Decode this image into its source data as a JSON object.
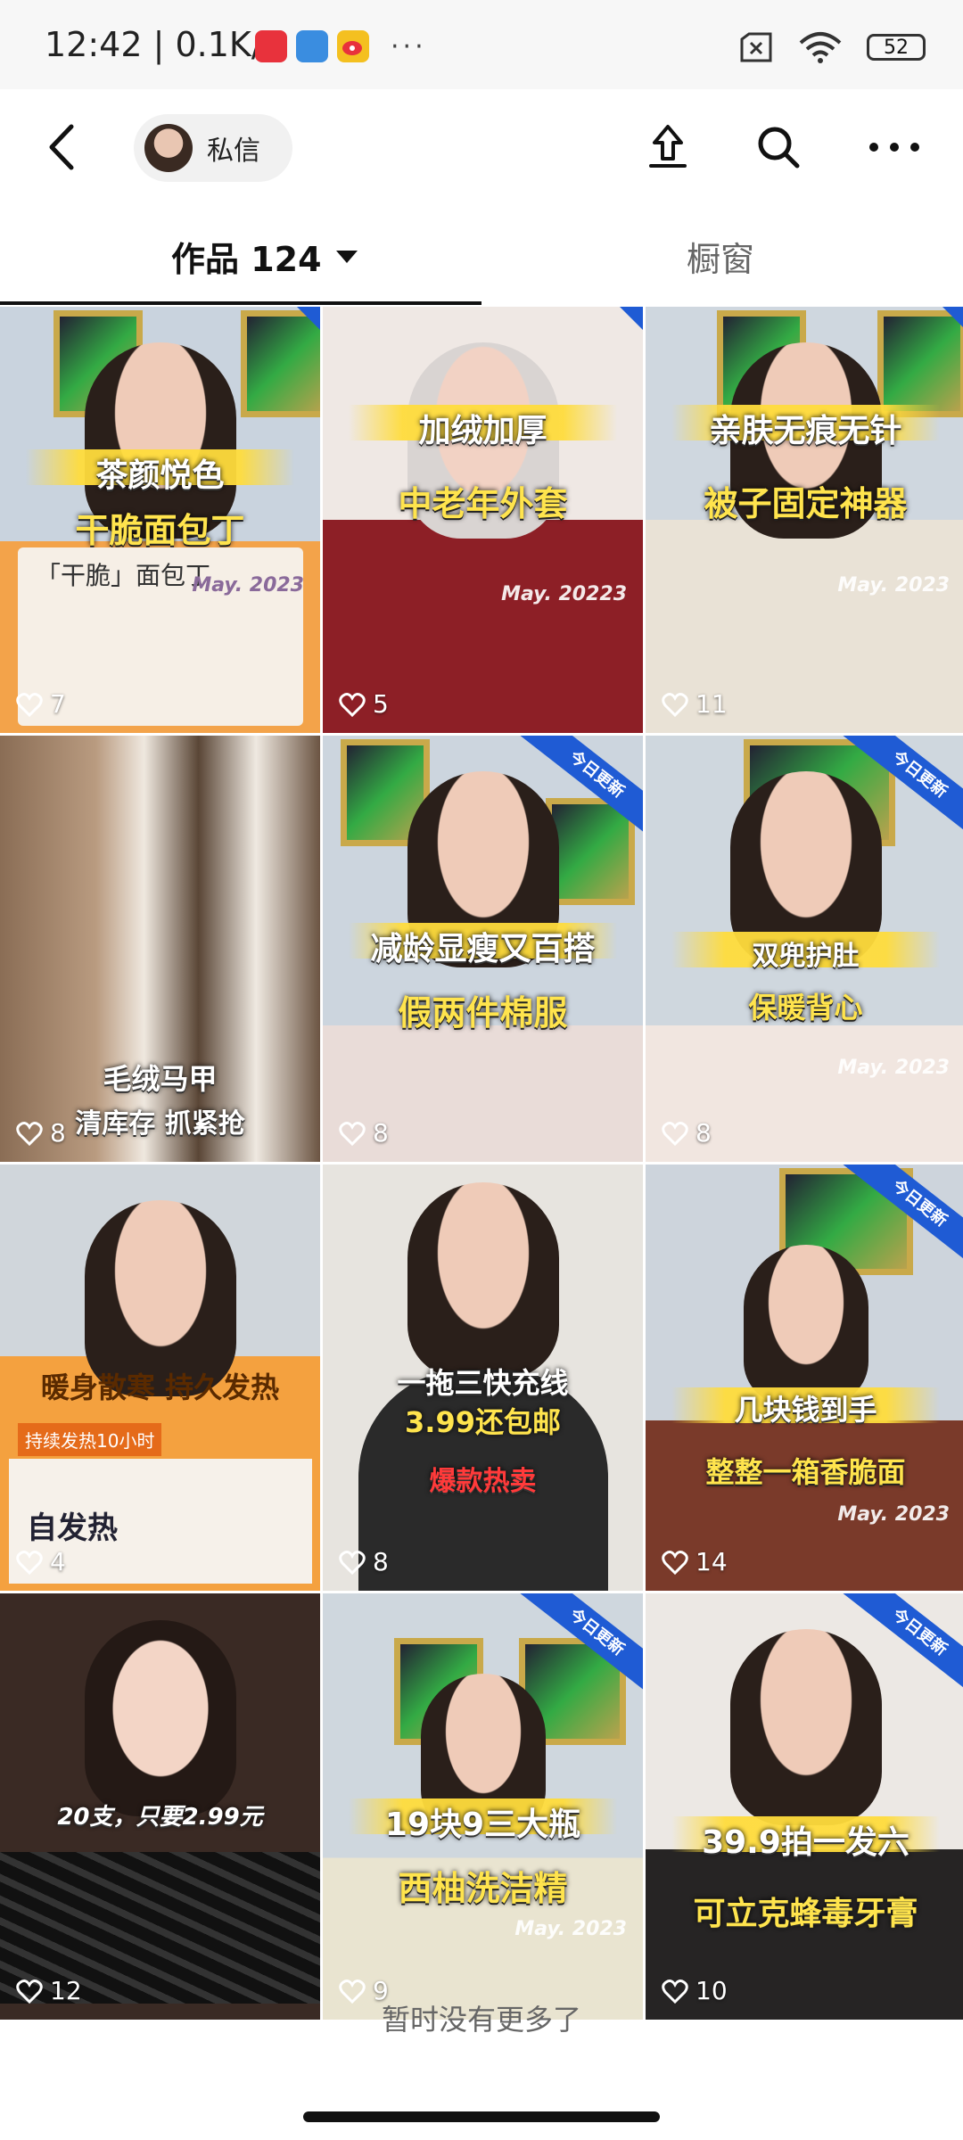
{
  "status_bar": {
    "time": "12:42",
    "net_speed": "| 0.1K/s",
    "battery": "52",
    "dots": "···"
  },
  "header": {
    "private_message": "私信"
  },
  "tabs": {
    "works_label": "作品 124",
    "shop_label": "橱窗"
  },
  "colors": {
    "ribbon": "#1f5bd4",
    "caption_yellow": "#ffe44d"
  },
  "tiles": [
    {
      "caption_top": "茶颜悦色",
      "caption_bottom": "干脆面包丁",
      "product": "「干脆」面包丁",
      "stamp": "May. 2023",
      "likes": "7",
      "ribbon": ""
    },
    {
      "caption_top": "加绒加厚",
      "caption_bottom": "中老年外套",
      "product": "",
      "stamp": "May. 20223",
      "likes": "5",
      "ribbon": ""
    },
    {
      "caption_top": "亲肤无痕无针",
      "caption_bottom": "被子固定神器",
      "product": "",
      "stamp": "May. 2023",
      "likes": "11",
      "ribbon": ""
    },
    {
      "caption_top": "毛绒马甲",
      "caption_bottom": "清库存 抓紧抢",
      "product": "",
      "stamp": "",
      "likes": "8",
      "ribbon": ""
    },
    {
      "caption_top": "减龄显瘦又百搭",
      "caption_bottom": "假两件棉服",
      "product": "",
      "stamp": "",
      "likes": "8",
      "ribbon": "今日更新"
    },
    {
      "caption_top": "双兜护肚",
      "caption_bottom": "保暖背心",
      "product": "",
      "stamp": "May. 2023",
      "likes": "8",
      "ribbon": "今日更新"
    },
    {
      "caption_top": "暖身散寒 持久发热",
      "caption_bottom": "自发热",
      "product": "持续发热10小时",
      "stamp": "",
      "likes": "4",
      "ribbon": ""
    },
    {
      "caption_top": "一拖三快充线",
      "caption_bottom": "3.99还包邮",
      "product": "爆款热卖",
      "stamp": "",
      "likes": "8",
      "ribbon": ""
    },
    {
      "caption_top": "几块钱到手",
      "caption_bottom": "整整一箱香脆面",
      "product": "",
      "stamp": "May. 2023",
      "likes": "14",
      "ribbon": "今日更新"
    },
    {
      "caption_top": "20支，只要2.99元",
      "caption_bottom": "",
      "product": "",
      "stamp": "",
      "likes": "12",
      "ribbon": ""
    },
    {
      "caption_top": "19块9三大瓶",
      "caption_bottom": "西柚洗洁精",
      "product": "",
      "stamp": "May. 2023",
      "likes": "9",
      "ribbon": "今日更新"
    },
    {
      "caption_top": "39.9拍一发六",
      "caption_bottom": "可立克蜂毒牙膏",
      "product": "",
      "stamp": "",
      "likes": "10",
      "ribbon": "今日更新"
    }
  ],
  "footer": {
    "no_more": "暂时没有更多了"
  }
}
